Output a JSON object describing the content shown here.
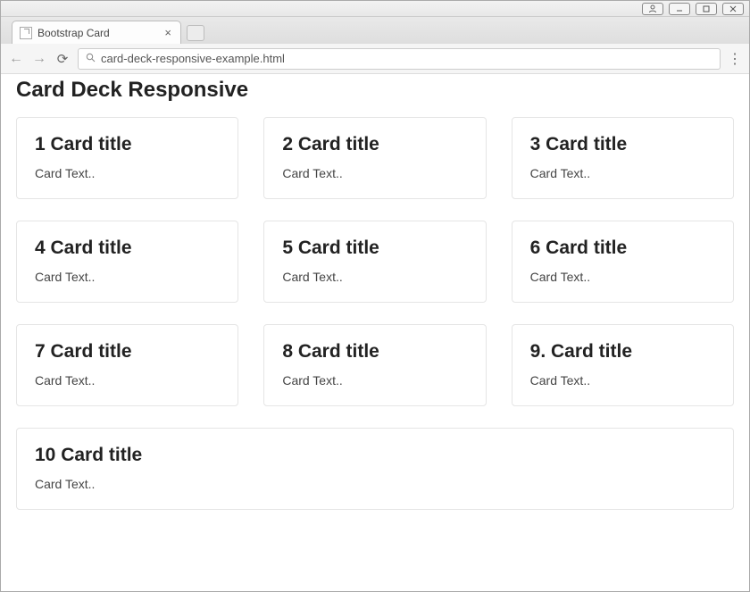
{
  "window": {
    "tab_title": "Bootstrap Card"
  },
  "toolbar": {
    "url": "card-deck-responsive-example.html"
  },
  "page": {
    "heading": "Card Deck Responsive"
  },
  "cards": [
    {
      "title": "1 Card title",
      "text": "Card Text.."
    },
    {
      "title": "2 Card title",
      "text": "Card Text.."
    },
    {
      "title": "3 Card title",
      "text": "Card Text.."
    },
    {
      "title": "4 Card title",
      "text": "Card Text.."
    },
    {
      "title": "5 Card title",
      "text": "Card Text.."
    },
    {
      "title": "6 Card title",
      "text": "Card Text.."
    },
    {
      "title": "7 Card title",
      "text": "Card Text.."
    },
    {
      "title": "8 Card title",
      "text": "Card Text.."
    },
    {
      "title": "9. Card title",
      "text": "Card Text.."
    },
    {
      "title": "10 Card title",
      "text": "Card Text.."
    }
  ]
}
